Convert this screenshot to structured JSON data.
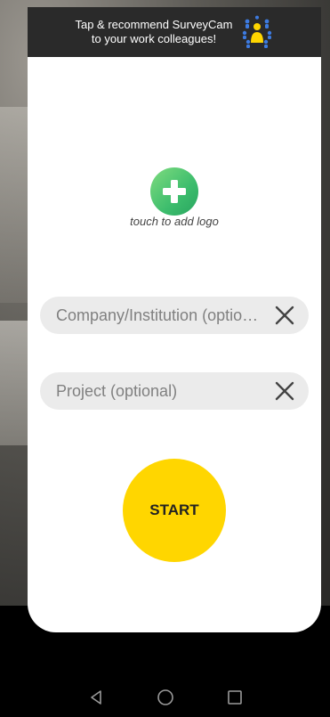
{
  "promo": {
    "line1": "Tap & recommend SurveyCam",
    "line2": "to your work colleagues!",
    "icon": "people-network-icon"
  },
  "logo": {
    "caption": "touch to add logo",
    "icon": "plus-icon"
  },
  "fields": {
    "company": {
      "placeholder": "Company/Institution (optional)",
      "value": ""
    },
    "project": {
      "placeholder": "Project (optional)",
      "value": ""
    }
  },
  "start": {
    "label": "START"
  },
  "navigation": {
    "back": "back-triangle-icon",
    "home": "home-circle-icon",
    "recents": "recents-square-icon"
  },
  "colors": {
    "accent": "#ffd600",
    "logo_green": "#3dbd6d",
    "banner": "#2a2a2a",
    "field_bg": "#ebebeb"
  }
}
